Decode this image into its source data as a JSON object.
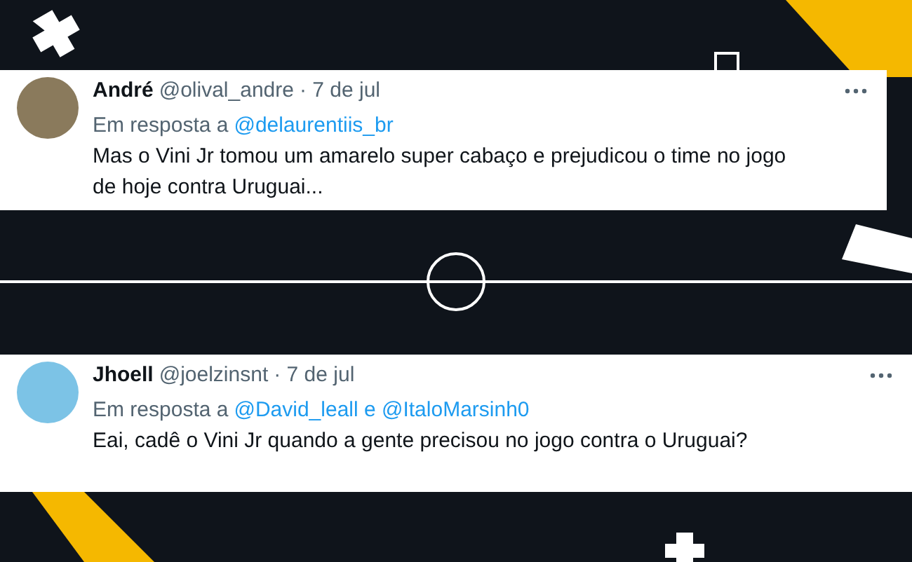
{
  "tweets": [
    {
      "name": "André",
      "handle": "@olival_andre",
      "date": "· 7 de jul",
      "reply_prefix": "Em resposta a",
      "reply_to": "@delaurentiis_br",
      "text": "Mas o Vini Jr tomou um amarelo super cabaço e prejudicou o time no jogo de hoje contra Uruguai..."
    },
    {
      "name": "Jhoell",
      "handle": "@joelzinsnt",
      "date": "· 7 de jul",
      "reply_prefix": "Em resposta a",
      "reply_to": "@David_leall e @ItaloMarsinh0",
      "text": "Eai, cadê o Vini Jr quando a gente precisou no jogo contra o Uruguai?"
    }
  ]
}
